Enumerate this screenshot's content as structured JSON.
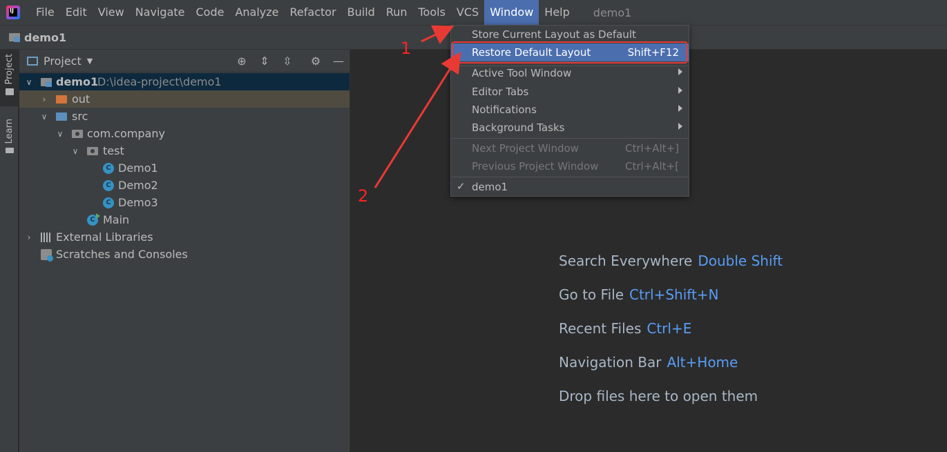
{
  "menubar": {
    "logo_text": "IJ",
    "items": [
      "File",
      "Edit",
      "View",
      "Navigate",
      "Code",
      "Analyze",
      "Refactor",
      "Build",
      "Run",
      "Tools",
      "VCS",
      "Window",
      "Help"
    ],
    "project_name": "demo1"
  },
  "navbar": {
    "project": "demo1"
  },
  "stripe": {
    "project_tab": "Project",
    "learn_tab": "Learn"
  },
  "project_panel": {
    "title": "Project",
    "tree": {
      "root_label": "demo1",
      "root_path": "D:\\idea-project\\demo1",
      "out": "out",
      "src": "src",
      "package": "com.company",
      "test": "test",
      "demo1": "Demo1",
      "demo2": "Demo2",
      "demo3": "Demo3",
      "main": "Main",
      "external_libraries": "External Libraries",
      "scratches": "Scratches and Consoles"
    },
    "class_icon_letter": "C"
  },
  "editor": {
    "hints": [
      {
        "label": "Search Everywhere",
        "key": "Double Shift"
      },
      {
        "label": "Go to File",
        "key": "Ctrl+Shift+N"
      },
      {
        "label": "Recent Files",
        "key": "Ctrl+E"
      },
      {
        "label": "Navigation Bar",
        "key": "Alt+Home"
      },
      {
        "label": "Drop files here to open them",
        "key": ""
      }
    ]
  },
  "window_menu": {
    "store_layout": "Store Current Layout as Default",
    "restore_layout": "Restore Default Layout",
    "restore_shortcut": "Shift+F12",
    "active_tool_window": "Active Tool Window",
    "editor_tabs": "Editor Tabs",
    "notifications": "Notifications",
    "background_tasks": "Background Tasks",
    "next_project_window": "Next Project Window",
    "next_shortcut": "Ctrl+Alt+]",
    "previous_project_window": "Previous Project Window",
    "previous_shortcut": "Ctrl+Alt+[",
    "current_project": "demo1"
  },
  "annotations": {
    "step1": "1",
    "step2": "2",
    "color": "#e83a35"
  }
}
